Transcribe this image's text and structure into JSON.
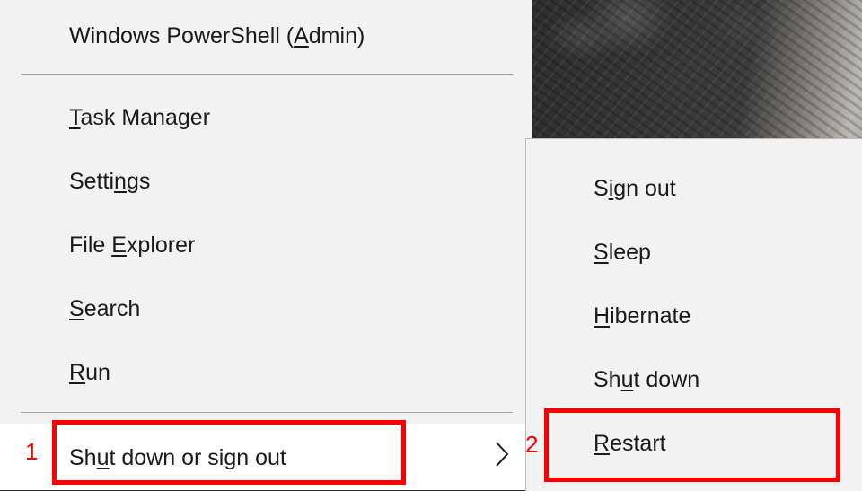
{
  "main_menu": {
    "items": [
      {
        "label": "Windows PowerShell (Admin)",
        "pre": "Windows PowerShell (",
        "ul": "A",
        "post": "dmin)"
      },
      {
        "label": "Task Manager",
        "pre": "",
        "ul": "T",
        "post": "ask Manager"
      },
      {
        "label": "Settings",
        "pre": "Setti",
        "ul": "n",
        "post": "gs"
      },
      {
        "label": "File Explorer",
        "pre": "File ",
        "ul": "E",
        "post": "xplorer"
      },
      {
        "label": "Search",
        "pre": "",
        "ul": "S",
        "post": "earch"
      },
      {
        "label": "Run",
        "pre": "",
        "ul": "R",
        "post": "un"
      },
      {
        "label": "Shut down or sign out",
        "pre": "Sh",
        "ul": "u",
        "post": "t down or sign out"
      }
    ]
  },
  "submenu": {
    "items": [
      {
        "label": "Sign out",
        "pre": "S",
        "ul": "i",
        "post": "gn out"
      },
      {
        "label": "Sleep",
        "pre": "",
        "ul": "S",
        "post": "leep"
      },
      {
        "label": "Hibernate",
        "pre": "",
        "ul": "H",
        "post": "ibernate"
      },
      {
        "label": "Shut down",
        "pre": "Sh",
        "ul": "u",
        "post": "t down"
      },
      {
        "label": "Restart",
        "pre": "",
        "ul": "R",
        "post": "estart"
      }
    ]
  },
  "annotations": {
    "step1": "1",
    "step2": "2",
    "color": "#ff0000"
  },
  "icons": {
    "submenu_arrow": "chevron-right-icon"
  }
}
